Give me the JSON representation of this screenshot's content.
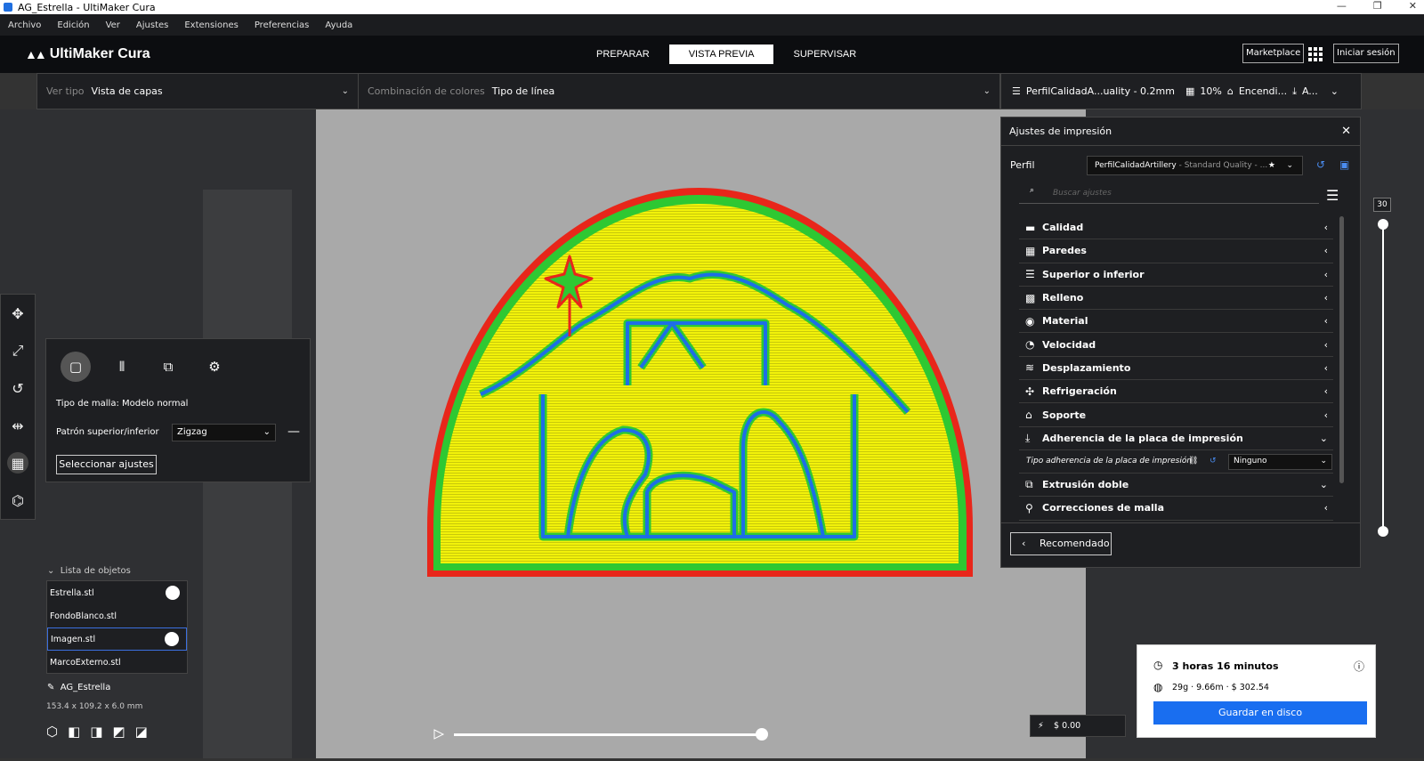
{
  "window": {
    "title": "AG_Estrella - UltiMaker Cura",
    "minimize": "—",
    "maximize": "❐",
    "close": "✕"
  },
  "menu": [
    "Archivo",
    "Edición",
    "Ver",
    "Ajustes",
    "Extensiones",
    "Preferencias",
    "Ayuda"
  ],
  "header": {
    "logo": "UltiMaker Cura",
    "stages": [
      "PREPARAR",
      "VISTA PREVIA",
      "SUPERVISAR"
    ],
    "active_stage": "VISTA PREVIA",
    "marketplace": "Marketplace",
    "signin": "Iniciar sesión"
  },
  "viewbar": {
    "view_type_label": "Ver tipo",
    "view_type": "Vista de capas",
    "color_scheme_label": "Combinación de colores",
    "color_scheme": "Tipo de línea"
  },
  "printbar": {
    "profile": "PerfilCalidadA...uality - 0.2mm",
    "infill": "10%",
    "support": "Encendi...",
    "adhesion": "A..."
  },
  "tools": [
    "move-icon",
    "scale-icon",
    "rotate-icon",
    "mirror-icon",
    "per-model-settings-icon",
    "support-blocker-icon"
  ],
  "per_model": {
    "mesh_type": "Tipo de malla: Modelo normal",
    "pattern_label": "Patrón superior/inferior",
    "pattern_value": "Zigzag",
    "select_settings": "Seleccionar ajustes"
  },
  "objects": {
    "header": "Lista de objetos",
    "items": [
      "Estrella.stl",
      "FondoBlanco.stl",
      "Imagen.stl",
      "MarcoExterno.stl"
    ],
    "project_name": "AG_Estrella",
    "dimensions": "153.4 x 109.2 x 6.0 mm"
  },
  "settings": {
    "title": "Ajustes de impresión",
    "profile_label": "Perfil",
    "profile_name": "PerfilCalidadArtillery",
    "profile_sub": " - Standard Quality - ...",
    "search_placeholder": "Buscar ajustes",
    "categories": [
      "Calidad",
      "Paredes",
      "Superior o inferior",
      "Relleno",
      "Material",
      "Velocidad",
      "Desplazamiento",
      "Refrigeración",
      "Soporte",
      "Adherencia de la placa de impresión"
    ],
    "adhesion_type_label": "Tipo adherencia de la placa de impresión",
    "adhesion_type_value": "Ninguno",
    "categories_after": [
      "Extrusión doble",
      "Correcciones de malla"
    ],
    "recommended": "Recomendado"
  },
  "layer": {
    "current": "30"
  },
  "summary": {
    "time": "3 horas 16 minutos",
    "material": "29g · 9.66m · $ 302.54",
    "save": "Guardar en disco"
  },
  "cost": "$ 0.00",
  "colors": {
    "accent": "#196ef0",
    "outer_wall": "#e8261a",
    "inner_wall": "#2ec832",
    "skin": "#f2f20a",
    "outline": "#1e6ee6"
  }
}
